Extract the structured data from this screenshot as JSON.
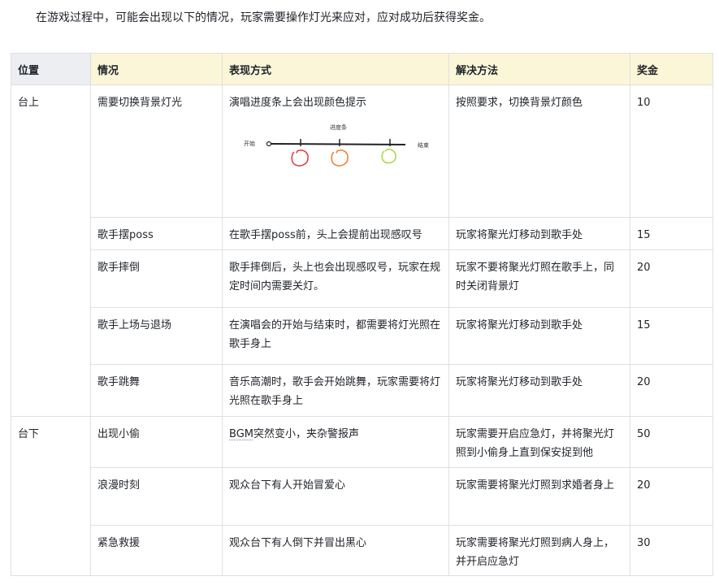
{
  "intro": "在游戏过程中，可能会出现以下的情况，玩家需要操作灯光来应对，应对成功后获得奖金。",
  "table": {
    "headers": {
      "position": "位置",
      "situation": "情况",
      "expression": "表现方式",
      "solution": "解决方法",
      "reward": "奖金"
    },
    "groups": [
      {
        "position": "台上",
        "rows": [
          {
            "situation": "需要切换背景灯光",
            "expression": "演唱进度条上会出现颜色提示",
            "solution": "按照要求，切换背景灯颜色",
            "reward": "10",
            "figure": {
              "title": "进度条",
              "start_label": "开始",
              "end_label": "结束",
              "marker_colors": [
                "#e8323a",
                "#f07a2a",
                "#a6d93a"
              ]
            }
          },
          {
            "situation": "歌手摆poss",
            "expression": "在歌手摆poss前，头上会提前出现感叹号",
            "solution": "玩家将聚光灯移动到歌手处",
            "reward": "15"
          },
          {
            "situation": "歌手摔倒",
            "expression": "歌手摔倒后，头上也会出现感叹号，玩家在规定时间内需要关灯。",
            "solution": "玩家不要将聚光灯照在歌手上，同时关闭背景灯",
            "reward": "20"
          },
          {
            "situation": "歌手上场与退场",
            "expression": "在演唱会的开始与结束时，都需要将灯光照在歌手身上",
            "solution": "玩家将聚光灯移动到歌手处",
            "reward": "15"
          },
          {
            "situation": "歌手跳舞",
            "expression": "音乐高潮时，歌手会开始跳舞，玩家需要将灯光照在歌手身上",
            "solution": "玩家将聚光灯移动到歌手处",
            "reward": "20"
          }
        ]
      },
      {
        "position": "台下",
        "rows": [
          {
            "situation": "出现小偷",
            "expression_prefix": "BGM",
            "expression_rest": "突然变小，夹杂警报声",
            "solution": "玩家需要开启应急灯，并将聚光灯照到小偷身上直到保安捉到他",
            "reward": "50"
          },
          {
            "situation": "浪漫时刻",
            "expression": "观众台下有人开始冒爱心",
            "solution": "玩家需要将聚光灯照到求婚者身上",
            "reward": "20"
          },
          {
            "situation": "紧急救援",
            "expression": "观众台下有人倒下并冒出黑心",
            "solution": "玩家需要将聚光灯照到病人身上，并开启应急灯",
            "reward": "30"
          }
        ]
      }
    ]
  }
}
